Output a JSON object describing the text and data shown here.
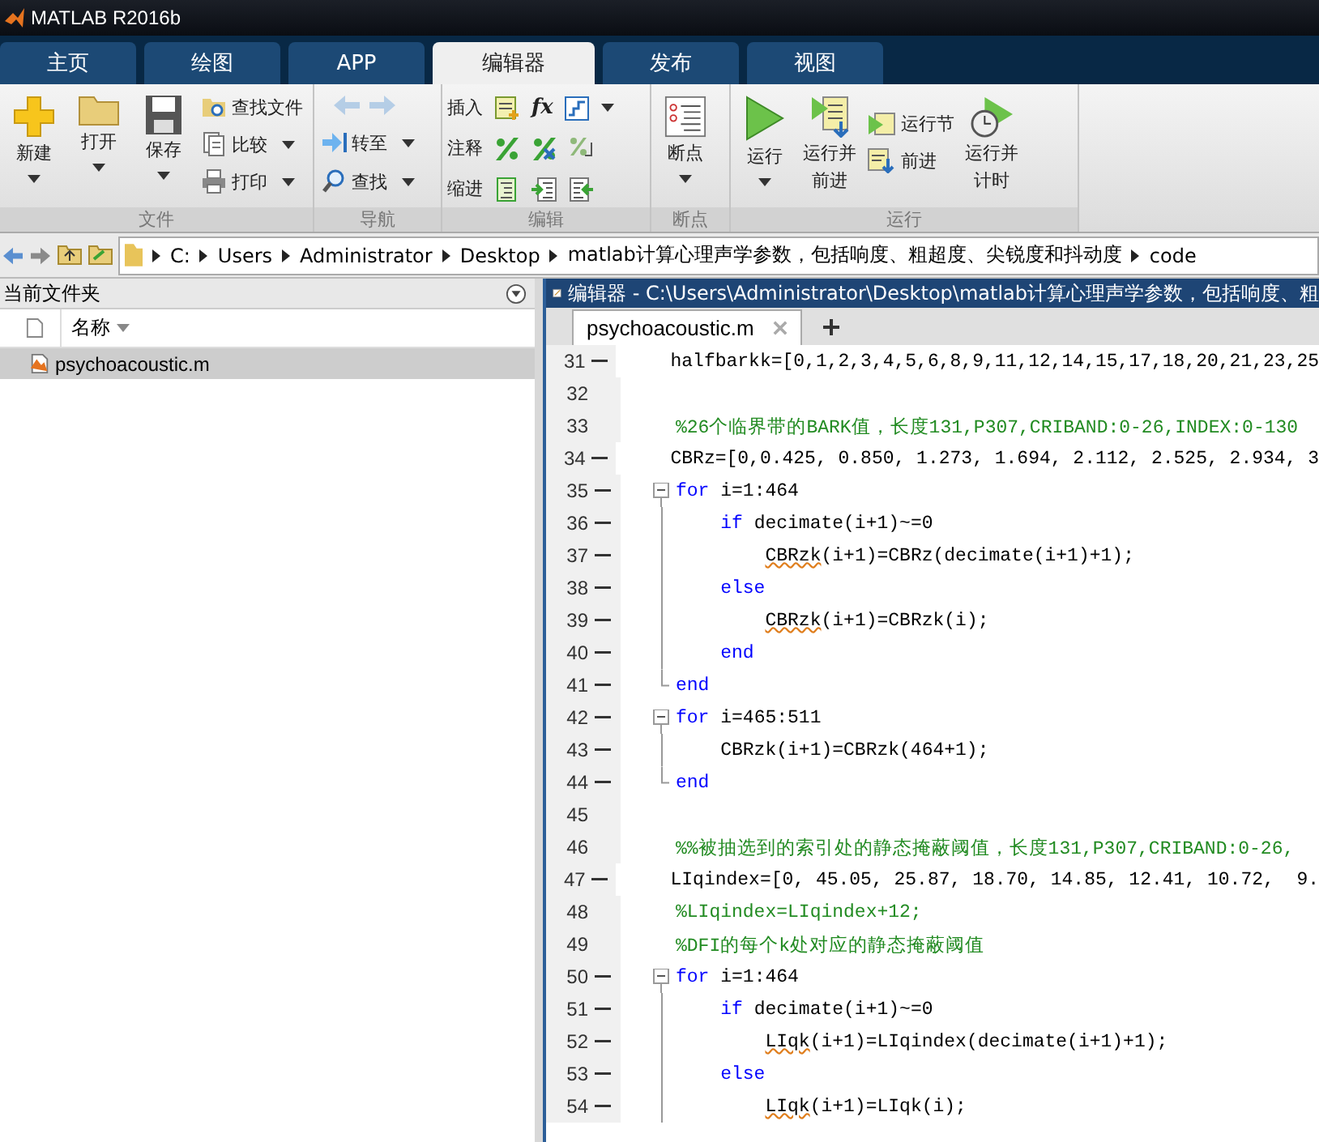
{
  "window": {
    "title": "MATLAB R2016b"
  },
  "tabs": [
    {
      "label": "主页",
      "selected": false
    },
    {
      "label": "绘图",
      "selected": false
    },
    {
      "label": "APP",
      "selected": false
    },
    {
      "label": "编辑器",
      "selected": true
    },
    {
      "label": "发布",
      "selected": false
    },
    {
      "label": "视图",
      "selected": false
    }
  ],
  "ribbon": {
    "file": {
      "label": "文件",
      "new": "新建",
      "open": "打开",
      "save": "保存",
      "find_files": "查找文件",
      "compare": "比较",
      "print": "打印"
    },
    "navigate": {
      "label": "导航",
      "back": {
        "disabled": true
      },
      "forward": {
        "disabled": true
      },
      "go_to": "转至",
      "find": "查找"
    },
    "edit": {
      "label": "编辑",
      "insert": "插入",
      "function_symbol": "fx",
      "comment": "注释",
      "indent": "缩进"
    },
    "breakpoints": {
      "label": "断点",
      "button": "断点"
    },
    "run": {
      "label": "运行",
      "run": "运行",
      "run_advance": [
        "运行并",
        "前进"
      ],
      "run_section": "运行节",
      "advance": "前进",
      "run_time": [
        "运行并",
        "计时"
      ]
    }
  },
  "address_bar": {
    "path": [
      "C:",
      "Users",
      "Administrator",
      "Desktop",
      "matlab计算心理声学参数，包括响度、粗超度、尖锐度和抖动度",
      "code"
    ]
  },
  "current_folder": {
    "title": "当前文件夹",
    "column": "名称",
    "files": [
      {
        "name": "psychoacoustic.m",
        "selected": true
      }
    ]
  },
  "editor": {
    "title": "编辑器 - C:\\Users\\Administrator\\Desktop\\matlab计算心理声学参数，包括响度、粗",
    "tabs": [
      {
        "label": "psychoacoustic.m",
        "selected": true
      }
    ],
    "lines": [
      {
        "number": "31",
        "kind": "plain",
        "executable": true,
        "segments": [
          {
            "kind": "plain",
            "text": "halfbarkk=[0,1,2,3,4,5,6,8,9,11,12,14,15,17,18,20,21,23,25"
          }
        ]
      },
      {
        "number": "32",
        "kind": "plain",
        "executable": false
      },
      {
        "number": "33",
        "kind": "plain",
        "executable": false,
        "segments": [
          {
            "kind": "comment",
            "text": "%26个临界带的BARK值，长度131,P307,CRIBAND:0-26,INDEX:0-130"
          }
        ]
      },
      {
        "number": "34",
        "kind": "plain",
        "executable": true,
        "segments": [
          {
            "kind": "plain",
            "text": "CBRz=[0,0.425, 0.850, 1.273, 1.694, 2.112, 2.525, 2.934, 3"
          }
        ]
      },
      {
        "number": "35",
        "kind": "open",
        "executable": true,
        "segments": [
          {
            "kind": "keyword",
            "text": "for"
          },
          {
            "kind": "plain",
            "text": " i=1:464"
          }
        ]
      },
      {
        "number": "36",
        "kind": "inner",
        "executable": true,
        "segments": [
          {
            "kind": "keyword",
            "text": "    if"
          },
          {
            "kind": "plain",
            "text": " decimate(i+1)~=0"
          }
        ]
      },
      {
        "number": "37",
        "kind": "inner",
        "executable": true,
        "segments": [
          {
            "kind": "warning",
            "text": "        CBRzk"
          },
          {
            "kind": "plain",
            "text": "(i+1)=CBRz(decimate(i+1)+1);"
          }
        ]
      },
      {
        "number": "38",
        "kind": "inner",
        "executable": true,
        "segments": [
          {
            "kind": "keyword",
            "text": "    else"
          }
        ]
      },
      {
        "number": "39",
        "kind": "inner",
        "executable": true,
        "segments": [
          {
            "kind": "warning",
            "text": "        CBRzk"
          },
          {
            "kind": "plain",
            "text": "(i+1)=CBRzk(i);"
          }
        ]
      },
      {
        "number": "40",
        "kind": "inner",
        "executable": true,
        "segments": [
          {
            "kind": "keyword",
            "text": "    end"
          }
        ]
      },
      {
        "number": "41",
        "kind": "close",
        "executable": true,
        "segments": [
          {
            "kind": "keyword",
            "text": "end"
          }
        ]
      },
      {
        "number": "42",
        "kind": "open",
        "executable": true,
        "segments": [
          {
            "kind": "keyword",
            "text": "for"
          },
          {
            "kind": "plain",
            "text": " i=465:511"
          }
        ]
      },
      {
        "number": "43",
        "kind": "inner",
        "executable": true,
        "segments": [
          {
            "kind": "plain",
            "text": "    CBRzk(i+1)=CBRzk(464+1);"
          }
        ]
      },
      {
        "number": "44",
        "kind": "close",
        "executable": true,
        "segments": [
          {
            "kind": "keyword",
            "text": "end"
          }
        ]
      },
      {
        "number": "45",
        "kind": "plain",
        "executable": false
      },
      {
        "number": "46",
        "kind": "plain",
        "executable": false,
        "segments": [
          {
            "kind": "comment",
            "text": "%%被抽选到的索引处的静态掩蔽阈值，长度131,P307,CRIBAND:0-26,"
          }
        ]
      },
      {
        "number": "47",
        "kind": "plain",
        "executable": true,
        "segments": [
          {
            "kind": "plain",
            "text": "LIqindex=[0, 45.05, 25.87, 18.70, 14.85, 12.41, 10.72,  9."
          }
        ]
      },
      {
        "number": "48",
        "kind": "plain",
        "executable": false,
        "segments": [
          {
            "kind": "comment",
            "text": "%LIqindex=LIqindex+12;"
          }
        ]
      },
      {
        "number": "49",
        "kind": "plain",
        "executable": false,
        "segments": [
          {
            "kind": "comment",
            "text": "%DFI的每个k处对应的静态掩蔽阈值"
          }
        ]
      },
      {
        "number": "50",
        "kind": "open",
        "executable": true,
        "segments": [
          {
            "kind": "keyword",
            "text": "for"
          },
          {
            "kind": "plain",
            "text": " i=1:464"
          }
        ]
      },
      {
        "number": "51",
        "kind": "inner",
        "executable": true,
        "segments": [
          {
            "kind": "keyword",
            "text": "    if"
          },
          {
            "kind": "plain",
            "text": " decimate(i+1)~=0"
          }
        ]
      },
      {
        "number": "52",
        "kind": "inner",
        "executable": true,
        "segments": [
          {
            "kind": "warning",
            "text": "        LIqk"
          },
          {
            "kind": "plain",
            "text": "(i+1)=LIqindex(decimate(i+1)+1);"
          }
        ]
      },
      {
        "number": "53",
        "kind": "inner",
        "executable": true,
        "segments": [
          {
            "kind": "keyword",
            "text": "    else"
          }
        ]
      },
      {
        "number": "54",
        "kind": "inner",
        "executable": true,
        "segments": [
          {
            "kind": "warning",
            "text": "        LIqk"
          },
          {
            "kind": "plain",
            "text": "(i+1)=LIqk(i);"
          }
        ]
      }
    ]
  }
}
